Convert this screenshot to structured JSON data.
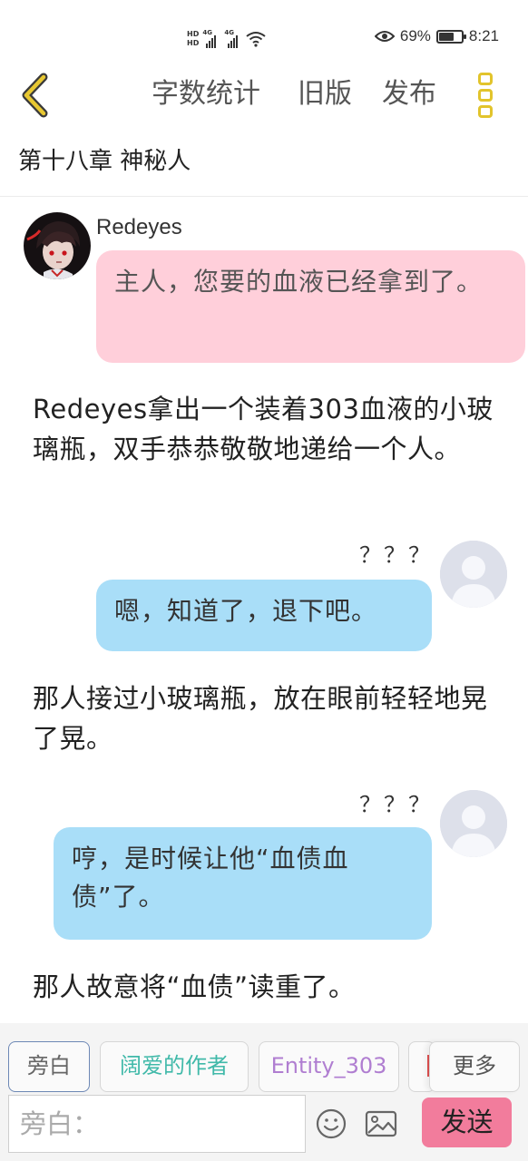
{
  "status_bar": {
    "hd_labels": [
      "HD",
      "HD"
    ],
    "signal_labels": [
      "4G",
      "4G"
    ],
    "battery_percent": "69%",
    "battery_level": 0.69,
    "time": "8:21"
  },
  "nav": {
    "word_count_label": "字数统计",
    "old_version_label": "旧版",
    "publish_label": "发布",
    "accent_color": "#e2c42c"
  },
  "chapter": {
    "title": "第十八章 神秘人"
  },
  "messages": [
    {
      "type": "character",
      "side": "left",
      "name": "Redeyes",
      "text": "主人，您要的血液已经拿到了。",
      "bubble_color": "#ffcfda"
    },
    {
      "type": "narration",
      "text": "Redeyes拿出一个装着303血液的小玻璃瓶，双手恭恭敬敬地递给一个人。"
    },
    {
      "type": "character",
      "side": "right",
      "name": "？？？",
      "text": "嗯，知道了，退下吧。",
      "bubble_color": "#a9def8"
    },
    {
      "type": "narration",
      "text": "那人接过小玻璃瓶，放在眼前轻轻地晃了晃。"
    },
    {
      "type": "character",
      "side": "right",
      "name": "？？？",
      "text": "哼，是时候让他“血债血债”了。",
      "bubble_color": "#a9def8"
    },
    {
      "type": "narration",
      "text": "那人故意将“血债”读重了。"
    }
  ],
  "role_chips": [
    {
      "label": "旁白",
      "color": "#666666"
    },
    {
      "label": "阔爱的作者",
      "color": "#40b9a9"
    },
    {
      "label": "Entity_303",
      "color": "#b07ed1"
    }
  ],
  "more_label": "更多",
  "input": {
    "placeholder": "旁白："
  },
  "send_label": "发送",
  "send_color": "#f27c9c",
  "icons": [
    "back-arrow-icon",
    "more-menu-icon",
    "eye-icon",
    "wifi-icon",
    "battery-icon",
    "emoji-icon",
    "image-icon",
    "default-avatar-icon"
  ]
}
